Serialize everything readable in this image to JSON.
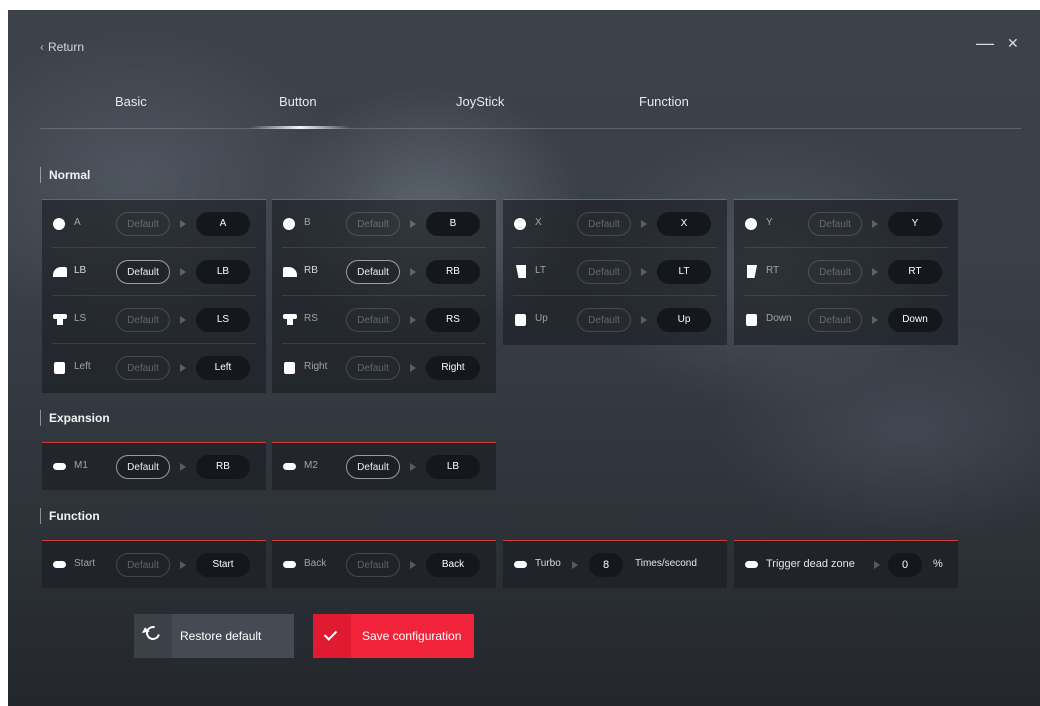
{
  "header": {
    "return_label": "Return",
    "minimize_symbol": "—",
    "close_symbol": "✕"
  },
  "tabs": {
    "basic": "Basic",
    "button": "Button",
    "joystick": "JoyStick",
    "function": "Function",
    "active": "Button"
  },
  "colors": {
    "accent": "#f0233a",
    "panel_border": "#d23a3a"
  },
  "sections": {
    "normal": "Normal",
    "expansion": "Expansion",
    "function": "Function"
  },
  "default_label": "Default",
  "normal": {
    "col1": [
      {
        "icon": "circle-button-icon",
        "label": "A",
        "default_active": false,
        "mapped": "A"
      },
      {
        "icon": "left-bumper-icon",
        "label": "LB",
        "default_active": true,
        "mapped": "LB"
      },
      {
        "icon": "left-stick-icon",
        "label": "LS",
        "default_active": false,
        "mapped": "LS"
      },
      {
        "icon": "dpad-left-icon",
        "label": "Left",
        "default_active": false,
        "mapped": "Left"
      }
    ],
    "col2": [
      {
        "icon": "circle-button-icon",
        "label": "B",
        "default_active": false,
        "mapped": "B"
      },
      {
        "icon": "right-bumper-icon",
        "label": "RB",
        "default_active": true,
        "mapped": "RB"
      },
      {
        "icon": "right-stick-icon",
        "label": "RS",
        "default_active": false,
        "mapped": "RS"
      },
      {
        "icon": "dpad-right-icon",
        "label": "Right",
        "default_active": false,
        "mapped": "Right"
      }
    ],
    "col3": [
      {
        "icon": "circle-button-icon",
        "label": "X",
        "default_active": false,
        "mapped": "X"
      },
      {
        "icon": "left-trigger-icon",
        "label": "LT",
        "default_active": false,
        "mapped": "LT"
      },
      {
        "icon": "dpad-up-icon",
        "label": "Up",
        "default_active": false,
        "mapped": "Up"
      }
    ],
    "col4": [
      {
        "icon": "circle-button-icon",
        "label": "Y",
        "default_active": false,
        "mapped": "Y"
      },
      {
        "icon": "right-trigger-icon",
        "label": "RT",
        "default_active": false,
        "mapped": "RT"
      },
      {
        "icon": "dpad-down-icon",
        "label": "Down",
        "default_active": false,
        "mapped": "Down"
      }
    ]
  },
  "expansion": {
    "m1": {
      "icon": "pill-button-icon",
      "label": "M1",
      "default_active": true,
      "mapped": "RB"
    },
    "m2": {
      "icon": "pill-button-icon",
      "label": "M2",
      "default_active": true,
      "mapped": "LB"
    }
  },
  "function": {
    "start": {
      "icon": "pill-button-icon",
      "label": "Start",
      "default_active": false,
      "mapped": "Start"
    },
    "back": {
      "icon": "pill-button-icon",
      "label": "Back",
      "default_active": false,
      "mapped": "Back"
    },
    "turbo": {
      "icon": "pill-button-icon",
      "label": "Turbo",
      "value": "8",
      "unit": "Times/second"
    },
    "trigger_dead_zone": {
      "icon": "pill-button-icon",
      "label": "Trigger dead zone",
      "value": "0",
      "unit": "%"
    }
  },
  "actions": {
    "restore": "Restore default",
    "save": "Save configuration"
  }
}
